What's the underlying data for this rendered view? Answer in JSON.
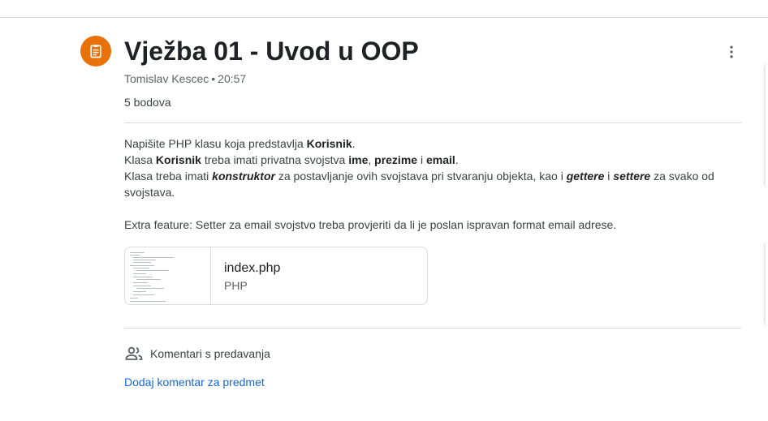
{
  "assignment": {
    "title": "Vježba 01 - Uvod u OOP",
    "author": "Tomislav Kescec",
    "separator": "•",
    "time": "20:57",
    "points": "5 bodova",
    "icon": "assignment-icon",
    "icon_color": "#e8710a"
  },
  "description": {
    "line1": [
      "Napišite PHP klasu koja predstavlja ",
      "Korisnik",
      "."
    ],
    "line2": [
      "Klasa ",
      "Korisnik",
      " treba imati privatna svojstva ",
      "ime",
      ", ",
      "prezime",
      " i ",
      "email",
      "."
    ],
    "line3": [
      "Klasa treba imati ",
      "konstruktor",
      " za postavljanje ovih svojstava pri stvaranju objekta, kao i ",
      "gettere",
      " i ",
      "settere",
      " za svako od svojstava."
    ],
    "line4": "Extra feature: Setter za email svojstvo treba provjeriti da li je poslan ispravan format email adrese."
  },
  "attachment": {
    "name": "index.php",
    "type": "PHP"
  },
  "comments": {
    "label": "Komentari s predavanja",
    "add_link": "Dodaj komentar za predmet",
    "link_color": "#1967d2"
  }
}
